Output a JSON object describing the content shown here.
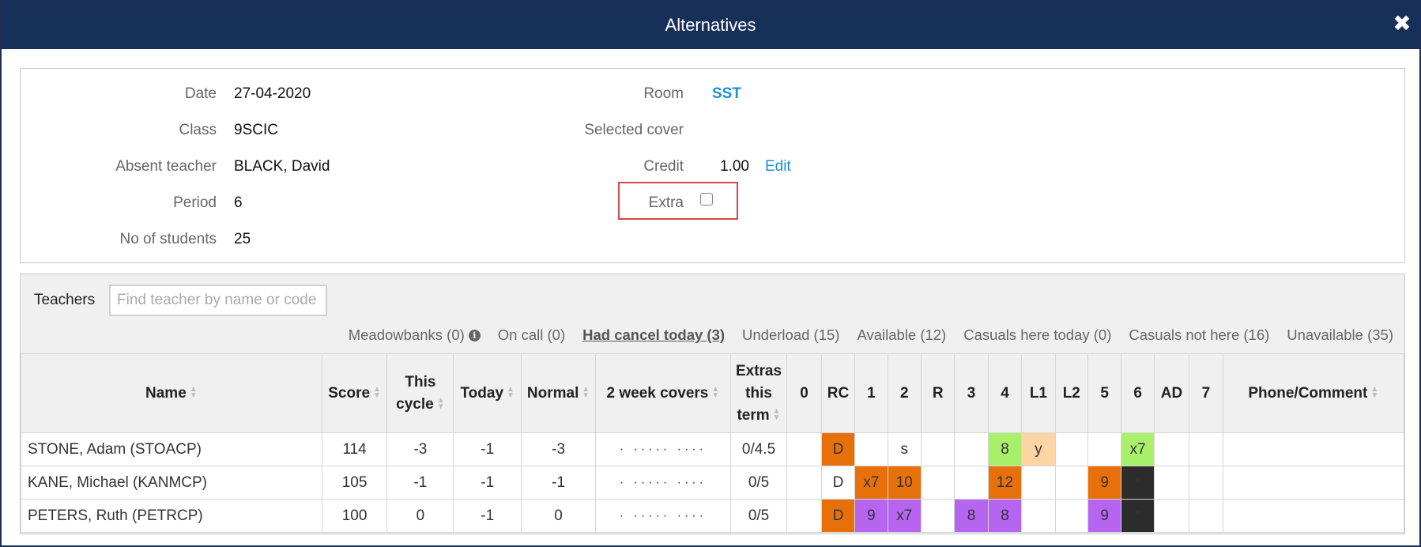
{
  "dialog": {
    "title": "Alternatives",
    "close_icon": "close-icon"
  },
  "details": {
    "date_label": "Date",
    "date_value": "27-04-2020",
    "class_label": "Class",
    "class_value": "9SCIC",
    "absent_label": "Absent teacher",
    "absent_value": "BLACK, David",
    "period_label": "Period",
    "period_value": "6",
    "students_label": "No of students",
    "students_value": "25",
    "room_label": "Room",
    "room_value": "SST",
    "cover_label": "Selected cover",
    "cover_value": "",
    "credit_label": "Credit",
    "credit_value": "1.00",
    "credit_edit": "Edit",
    "extra_label": "Extra",
    "extra_checked": false
  },
  "teachers": {
    "title": "Teachers",
    "search_placeholder": "Find teacher by name or code",
    "filters": [
      {
        "label": "Meadowbanks (0)",
        "has_info": true,
        "active": false
      },
      {
        "label": "On call (0)",
        "active": false
      },
      {
        "label": "Had cancel today (3)",
        "active": true
      },
      {
        "label": "Underload (15)",
        "active": false
      },
      {
        "label": "Available (12)",
        "active": false
      },
      {
        "label": "Casuals here today (0)",
        "active": false
      },
      {
        "label": "Casuals not here (16)",
        "active": false
      },
      {
        "label": "Unavailable (35)",
        "active": false
      }
    ],
    "columns": {
      "name": "Name",
      "score": "Score",
      "this_cycle_1": "This",
      "this_cycle_2": "cycle",
      "today": "Today",
      "normal": "Normal",
      "two_week": "2 week covers",
      "extras_1": "Extras",
      "extras_2": "this",
      "extras_3": "term",
      "periods": [
        "0",
        "RC",
        "1",
        "2",
        "R",
        "3",
        "4",
        "L1",
        "L2",
        "5",
        "6",
        "AD",
        "7"
      ],
      "phone": "Phone/Comment"
    },
    "rows": [
      {
        "name": "STONE, Adam (STOACP)",
        "score": "114",
        "this_cycle": "-3",
        "today": "-1",
        "normal": "-3",
        "two_week": "· ····· ····",
        "extras": "0/4.5",
        "periods": [
          {
            "v": "",
            "c": ""
          },
          {
            "v": "D",
            "c": "orange"
          },
          {
            "v": "",
            "c": ""
          },
          {
            "v": "s",
            "c": ""
          },
          {
            "v": "",
            "c": ""
          },
          {
            "v": "",
            "c": ""
          },
          {
            "v": "8",
            "c": "green"
          },
          {
            "v": "y",
            "c": "peach"
          },
          {
            "v": "",
            "c": ""
          },
          {
            "v": "",
            "c": ""
          },
          {
            "v": "x7",
            "c": "green"
          },
          {
            "v": "",
            "c": ""
          },
          {
            "v": "",
            "c": ""
          }
        ],
        "phone": ""
      },
      {
        "name": "KANE, Michael (KANMCP)",
        "score": "105",
        "this_cycle": "-1",
        "today": "-1",
        "normal": "-1",
        "two_week": "· ····· ····",
        "extras": "0/5",
        "periods": [
          {
            "v": "",
            "c": ""
          },
          {
            "v": "D",
            "c": ""
          },
          {
            "v": "x7",
            "c": "orange"
          },
          {
            "v": "10",
            "c": "orange"
          },
          {
            "v": "",
            "c": ""
          },
          {
            "v": "",
            "c": ""
          },
          {
            "v": "12",
            "c": "orange"
          },
          {
            "v": "",
            "c": ""
          },
          {
            "v": "",
            "c": ""
          },
          {
            "v": "9",
            "c": "orange"
          },
          {
            "v": "*",
            "c": "black"
          },
          {
            "v": "",
            "c": ""
          },
          {
            "v": "",
            "c": ""
          }
        ],
        "phone": ""
      },
      {
        "name": "PETERS, Ruth (PETRCP)",
        "score": "100",
        "this_cycle": "0",
        "today": "-1",
        "normal": "0",
        "two_week": "· ····· ····",
        "extras": "0/5",
        "periods": [
          {
            "v": "",
            "c": ""
          },
          {
            "v": "D",
            "c": "orange"
          },
          {
            "v": "9",
            "c": "purple"
          },
          {
            "v": "x7",
            "c": "purple"
          },
          {
            "v": "",
            "c": ""
          },
          {
            "v": "8",
            "c": "purple"
          },
          {
            "v": "8",
            "c": "purple"
          },
          {
            "v": "",
            "c": ""
          },
          {
            "v": "",
            "c": ""
          },
          {
            "v": "9",
            "c": "purple"
          },
          {
            "v": "*",
            "c": "black"
          },
          {
            "v": "",
            "c": ""
          },
          {
            "v": "",
            "c": ""
          }
        ],
        "phone": ""
      }
    ]
  },
  "colors": {
    "header_bg": "#17305a",
    "link": "#1a8fd8",
    "orange": "#e8700a",
    "green": "#a8f06a",
    "peach": "#fdd4a3",
    "purple": "#b565f0",
    "black": "#2c2c2c",
    "highlight": "#d9434b"
  }
}
